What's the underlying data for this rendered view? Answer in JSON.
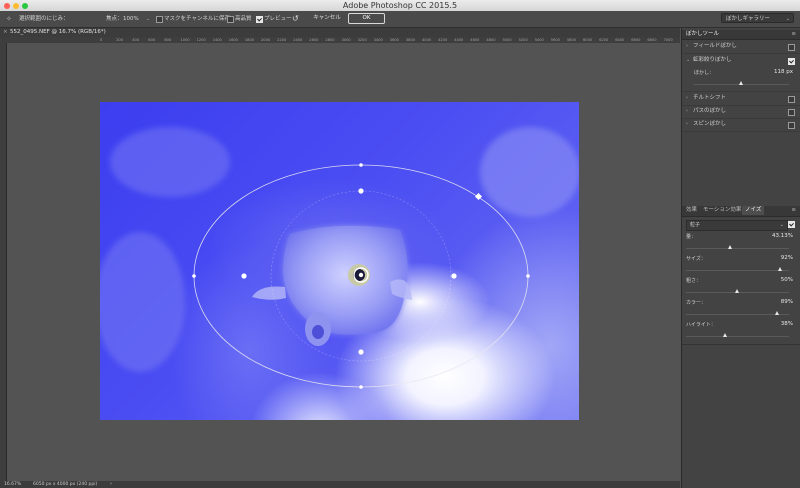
{
  "window": {
    "title": "Adobe Photoshop CC 2015.5",
    "traffic_lights": [
      "#fe5f57",
      "#febc2e",
      "#28c840"
    ]
  },
  "options": {
    "blur_edge_label": "選択範囲のにじみ：",
    "focus_label": "焦点：",
    "focus_value": "100%",
    "save_mask_label": "マスクをチャンネルに保存",
    "high_quality_label": "高品質",
    "preview_label": "プレビュー",
    "cancel_label": "キャンセル",
    "ok_label": "OK",
    "workspace_value": "ぼかしギャラリー"
  },
  "document": {
    "tab_label": "552_0495.NEF @ 16.7% (RGB/16*)",
    "ruler_ticks": [
      "0",
      "200",
      "400",
      "600",
      "800",
      "1000",
      "1200",
      "1400",
      "1600",
      "1800",
      "2000",
      "2200",
      "2400",
      "2600",
      "2800",
      "3000",
      "3200",
      "3400",
      "3600",
      "3800",
      "4000",
      "4200",
      "4400",
      "4600",
      "4800",
      "5000",
      "5200",
      "5400",
      "5600",
      "5800",
      "6000",
      "6200",
      "6400",
      "6600",
      "6800",
      "7000"
    ],
    "zoom": "16.67%",
    "doc_info": "6050 px x 4000 px (240 ppi)"
  },
  "blur_tools": {
    "header": "ぼかしツール",
    "field_blur": "フィールドぼかし",
    "iris_blur": "虹彩絞りぼかし",
    "blur_label": "ぼかし：",
    "blur_value": "118 px",
    "blur_fraction": 0.5,
    "tilt_shift": "チルトシフト",
    "path_blur": "パスのぼかし",
    "spin_blur": "スピンぼかし"
  },
  "effects": {
    "tabs": [
      "効果",
      "モーション効果",
      "ノイズ"
    ],
    "active_tab": "ノイズ",
    "noise_type": "粒子",
    "sliders": [
      {
        "label": "量：",
        "value": "43.13%",
        "fraction": 0.43
      },
      {
        "label": "サイズ：",
        "value": "92%",
        "fraction": 0.92
      },
      {
        "label": "粗さ：",
        "value": "50%",
        "fraction": 0.5
      },
      {
        "label": "カラー：",
        "value": "89%",
        "fraction": 0.89
      },
      {
        "label": "ハイライト：",
        "value": "38%",
        "fraction": 0.38
      }
    ]
  }
}
